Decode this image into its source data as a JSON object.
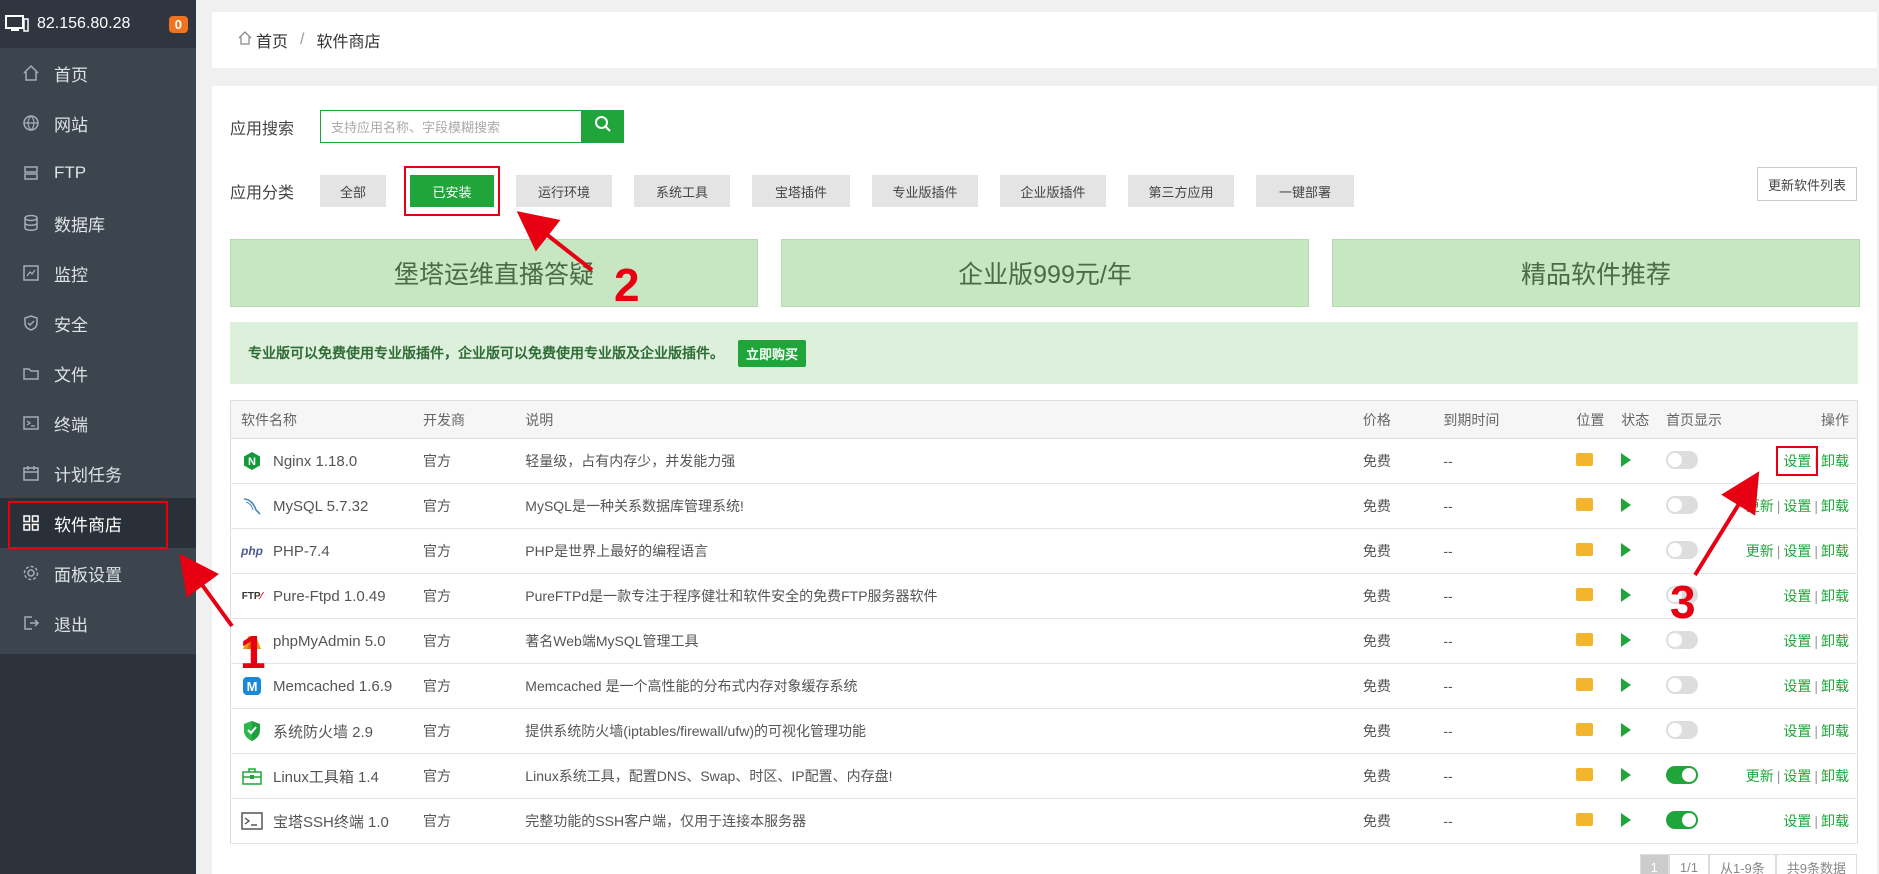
{
  "server": {
    "ip": "82.156.80.28",
    "badge": "0"
  },
  "sidebar": {
    "items": [
      {
        "label": "首页",
        "icon": "home-icon"
      },
      {
        "label": "网站",
        "icon": "globe-icon"
      },
      {
        "label": "FTP",
        "icon": "ftp-icon"
      },
      {
        "label": "数据库",
        "icon": "database-icon"
      },
      {
        "label": "监控",
        "icon": "monitor-icon"
      },
      {
        "label": "安全",
        "icon": "shield-icon"
      },
      {
        "label": "文件",
        "icon": "folder-icon"
      },
      {
        "label": "终端",
        "icon": "terminal-icon"
      },
      {
        "label": "计划任务",
        "icon": "calendar-icon"
      },
      {
        "label": "软件商店",
        "icon": "apps-icon"
      },
      {
        "label": "面板设置",
        "icon": "gear-icon"
      },
      {
        "label": "退出",
        "icon": "logout-icon"
      }
    ]
  },
  "breadcrumb": {
    "home": "首页",
    "sep": "/",
    "current": "软件商店"
  },
  "search": {
    "label": "应用搜索",
    "placeholder": "支持应用名称、字段模糊搜索"
  },
  "category": {
    "label": "应用分类",
    "tabs": [
      "全部",
      "已安装",
      "运行环境",
      "系统工具",
      "宝塔插件",
      "专业版插件",
      "企业版插件",
      "第三方应用",
      "一键部署"
    ],
    "update_button": "更新软件列表"
  },
  "banners": [
    "堡塔运维直播答疑",
    "企业版999元/年",
    "精品软件推荐"
  ],
  "notice": {
    "text": "专业版可以免费使用专业版插件，企业版可以免费使用专业版及企业版插件。",
    "buy": "立即购买"
  },
  "table": {
    "headers": [
      "软件名称",
      "开发商",
      "说明",
      "价格",
      "到期时间",
      "位置",
      "状态",
      "首页显示",
      "操作"
    ],
    "rows": [
      {
        "name": "Nginx 1.18.0",
        "dev": "官方",
        "desc": "轻量级，占有内存少，并发能力强",
        "price": "免费",
        "expire": "--",
        "home": false,
        "update": "",
        "settings": "设置",
        "uninstall": "卸载"
      },
      {
        "name": "MySQL 5.7.32",
        "dev": "官方",
        "desc": "MySQL是一种关系数据库管理系统!",
        "price": "免费",
        "expire": "--",
        "home": false,
        "update": "更新",
        "settings": "设置",
        "uninstall": "卸载"
      },
      {
        "name": "PHP-7.4",
        "dev": "官方",
        "desc": "PHP是世界上最好的编程语言",
        "price": "免费",
        "expire": "--",
        "home": false,
        "update": "更新",
        "settings": "设置",
        "uninstall": "卸载"
      },
      {
        "name": "Pure-Ftpd 1.0.49",
        "dev": "官方",
        "desc": "PureFTPd是一款专注于程序健壮和软件安全的免费FTP服务器软件",
        "price": "免费",
        "expire": "--",
        "home": false,
        "update": "",
        "settings": "设置",
        "uninstall": "卸载"
      },
      {
        "name": "phpMyAdmin 5.0",
        "dev": "官方",
        "desc": "著名Web端MySQL管理工具",
        "price": "免费",
        "expire": "--",
        "home": false,
        "update": "",
        "settings": "设置",
        "uninstall": "卸载"
      },
      {
        "name": "Memcached 1.6.9",
        "dev": "官方",
        "desc": "Memcached 是一个高性能的分布式内存对象缓存系统",
        "price": "免费",
        "expire": "--",
        "home": false,
        "update": "",
        "settings": "设置",
        "uninstall": "卸载"
      },
      {
        "name": "系统防火墙 2.9",
        "dev": "官方",
        "desc": "提供系统防火墙(iptables/firewall/ufw)的可视化管理功能",
        "price": "免费",
        "expire": "--",
        "home": false,
        "update": "",
        "settings": "设置",
        "uninstall": "卸载"
      },
      {
        "name": "Linux工具箱 1.4",
        "dev": "官方",
        "desc": "Linux系统工具，配置DNS、Swap、时区、IP配置、内存盘!",
        "price": "免费",
        "expire": "--",
        "home": true,
        "update": "更新",
        "settings": "设置",
        "uninstall": "卸载"
      },
      {
        "name": "宝塔SSH终端 1.0",
        "dev": "官方",
        "desc": "完整功能的SSH客户端，仅用于连接本服务器",
        "price": "免费",
        "expire": "--",
        "home": true,
        "update": "",
        "settings": "设置",
        "uninstall": "卸载"
      }
    ]
  },
  "pager": {
    "current": "1",
    "pages": "1/1",
    "range": "从1-9条",
    "total": "共9条数据"
  },
  "annotations": [
    "1",
    "2",
    "3"
  ]
}
